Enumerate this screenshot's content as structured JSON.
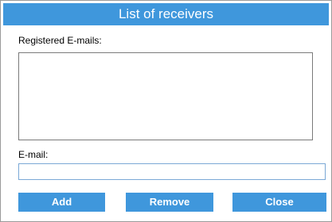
{
  "dialog": {
    "title": "List of receivers",
    "registered_label": "Registered E-mails:",
    "registered_emails": [],
    "email_label": "E-mail:",
    "email_value": ""
  },
  "buttons": {
    "add": "Add",
    "remove": "Remove",
    "close": "Close"
  },
  "colors": {
    "accent": "#3f97dc",
    "border": "#9a9a9a"
  }
}
